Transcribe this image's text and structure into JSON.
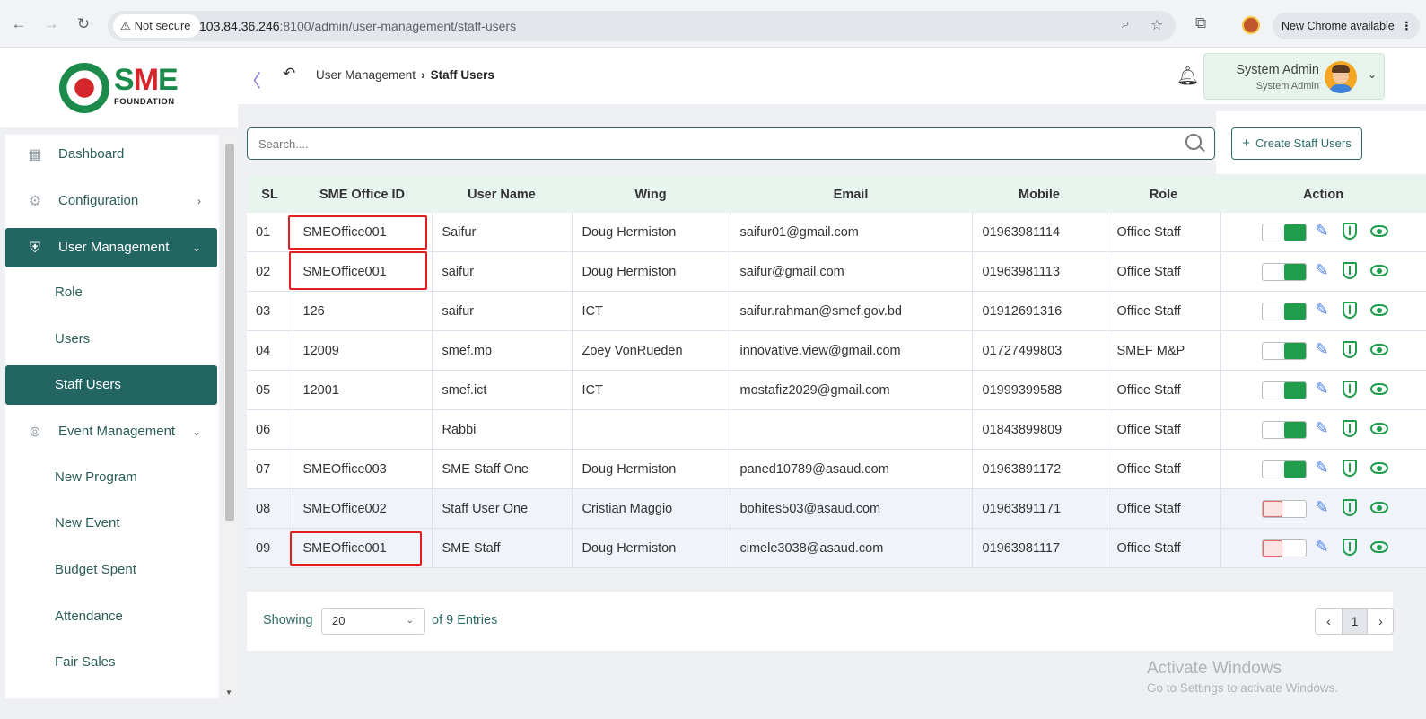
{
  "browser": {
    "security_label": "Not secure",
    "url_host": "103.84.36.246",
    "url_rest": ":8100/admin/user-management/staff-users",
    "update_label": "New Chrome available"
  },
  "brand": {
    "logo_text_pre": "S",
    "logo_text_mid": "M",
    "logo_text_post": "E",
    "logo_sub": "FOUNDATION"
  },
  "sidebar": {
    "items": [
      {
        "label": "Dashboard",
        "icon": "grid-icon"
      },
      {
        "label": "Configuration",
        "icon": "config-icon"
      },
      {
        "label": "User Management",
        "icon": "user-shield-icon"
      },
      {
        "label": "Role"
      },
      {
        "label": "Users"
      },
      {
        "label": "Staff Users"
      },
      {
        "label": "Event Management",
        "icon": "lock-icon"
      },
      {
        "label": "New Program"
      },
      {
        "label": "New Event"
      },
      {
        "label": "Budget Spent"
      },
      {
        "label": "Attendance"
      },
      {
        "label": "Fair Sales"
      }
    ]
  },
  "header": {
    "breadcrumb_parent": "User Management",
    "breadcrumb_current": "Staff Users",
    "user_name": "System Admin",
    "user_role": "System Admin"
  },
  "toolbar": {
    "search_placeholder": "Search....",
    "create_label": "Create Staff Users"
  },
  "table": {
    "columns": [
      "SL",
      "SME Office ID",
      "User Name",
      "Wing",
      "Email",
      "Mobile",
      "Role",
      "Action"
    ],
    "rows": [
      {
        "sl": "01",
        "office_id": "SMEOffice001",
        "user": "Saifur",
        "wing": "Doug Hermiston",
        "email": "saifur01@gmail.com",
        "mobile": "01963981114",
        "role": "Office Staff",
        "active": true
      },
      {
        "sl": "02",
        "office_id": "SMEOffice001",
        "user": "saifur",
        "wing": "Doug Hermiston",
        "email": "saifur@gmail.com",
        "mobile": "01963981113",
        "role": "Office Staff",
        "active": true
      },
      {
        "sl": "03",
        "office_id": "126",
        "user": "saifur",
        "wing": "ICT",
        "email": "saifur.rahman@smef.gov.bd",
        "mobile": "01912691316",
        "role": "Office Staff",
        "active": true
      },
      {
        "sl": "04",
        "office_id": "12009",
        "user": "smef.mp",
        "wing": "Zoey VonRueden",
        "email": "innovative.view@gmail.com",
        "mobile": "01727499803",
        "role": "SMEF M&P",
        "active": true
      },
      {
        "sl": "05",
        "office_id": "12001",
        "user": "smef.ict",
        "wing": "ICT",
        "email": "mostafiz2029@gmail.com",
        "mobile": "01999399588",
        "role": "Office Staff",
        "active": true
      },
      {
        "sl": "06",
        "office_id": "",
        "user": "Rabbi",
        "wing": "",
        "email": "",
        "mobile": "01843899809",
        "role": "Office Staff",
        "active": true
      },
      {
        "sl": "07",
        "office_id": "SMEOffice003",
        "user": "SME Staff One",
        "wing": "Doug Hermiston",
        "email": "paned10789@asaud.com",
        "mobile": "01963891172",
        "role": "Office Staff",
        "active": true
      },
      {
        "sl": "08",
        "office_id": "SMEOffice002",
        "user": "Staff User One",
        "wing": "Cristian Maggio",
        "email": "bohites503@asaud.com",
        "mobile": "01963891171",
        "role": "Office Staff",
        "active": false
      },
      {
        "sl": "09",
        "office_id": "SMEOffice001",
        "user": "SME Staff",
        "wing": "Doug Hermiston",
        "email": "cimele3038@asaud.com",
        "mobile": "01963981117",
        "role": "Office Staff",
        "active": false
      }
    ]
  },
  "pagination": {
    "showing_label": "Showing",
    "page_size": "20",
    "entries_label": "of 9 Entries",
    "current_page": "1"
  },
  "watermark": {
    "line1": "Activate Windows",
    "line2": "Go to Settings to activate Windows."
  },
  "colors": {
    "primary": "#236562",
    "toggle_on": "#1f9d4c",
    "highlight": "#e02020"
  }
}
